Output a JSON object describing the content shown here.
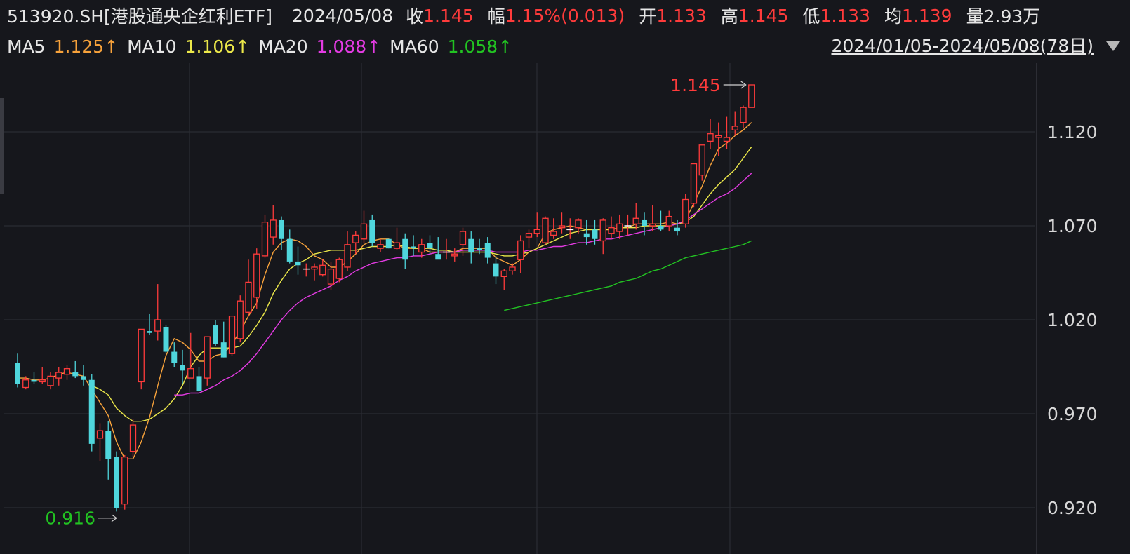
{
  "header": {
    "symbol": "513920.SH[港股通央企红利ETF]",
    "date": "2024/05/08",
    "close_label": "收",
    "close_value": "1.145",
    "change_label": "幅",
    "change_value": "1.15%(0.013)",
    "open_label": "开",
    "open_value": "1.133",
    "high_label": "高",
    "high_value": "1.145",
    "low_label": "低",
    "low_value": "1.133",
    "avg_label": "均",
    "avg_value": "1.139",
    "volume_label": "量",
    "volume_value": "2.93万"
  },
  "ma_legend": [
    {
      "label": "MA5",
      "value": "1.125↑",
      "color": "#f7a23b"
    },
    {
      "label": "MA10",
      "value": "1.106↑",
      "color": "#ece84a"
    },
    {
      "label": "MA20",
      "value": "1.088↑",
      "color": "#e43be3"
    },
    {
      "label": "MA60",
      "value": "1.058↑",
      "color": "#22c322"
    }
  ],
  "range_text": "2024/01/05-2024/05/08(78日)",
  "icons": {
    "range_dropdown": "triangle-down-icon"
  },
  "colors": {
    "background": "#16171c",
    "up": "#ff3b3b",
    "down": "#4fd6dc",
    "low_marker": "#22c322",
    "grid": "#2b2c33"
  },
  "chart_data": {
    "type": "candlestick",
    "y_ticks": [
      "1.120",
      "1.070",
      "1.020",
      "0.970",
      "0.920"
    ],
    "ylim": [
      0.908,
      1.17
    ],
    "high_marker": "1.145",
    "low_marker": "0.916",
    "ohlc": [
      [
        0.997,
        1.002,
        0.984,
        0.986
      ],
      [
        0.984,
        0.99,
        0.983,
        0.988
      ],
      [
        0.988,
        0.992,
        0.986,
        0.987
      ],
      [
        0.987,
        0.995,
        0.986,
        0.988
      ],
      [
        0.985,
        0.992,
        0.983,
        0.99
      ],
      [
        0.989,
        0.995,
        0.985,
        0.992
      ],
      [
        0.991,
        0.996,
        0.988,
        0.994
      ],
      [
        0.992,
        0.998,
        0.989,
        0.99
      ],
      [
        0.99,
        0.996,
        0.985,
        0.988
      ],
      [
        0.988,
        0.991,
        0.95,
        0.954
      ],
      [
        0.957,
        0.965,
        0.945,
        0.961
      ],
      [
        0.961,
        0.966,
        0.935,
        0.946
      ],
      [
        0.947,
        0.95,
        0.918,
        0.92
      ],
      [
        0.922,
        0.948,
        0.919,
        0.947
      ],
      [
        0.95,
        0.967,
        0.947,
        0.964
      ],
      [
        0.987,
        1.012,
        0.983,
        1.015
      ],
      [
        1.014,
        1.023,
        1.012,
        1.013
      ],
      [
        1.014,
        1.039,
        1.009,
        1.02
      ],
      [
        1.016,
        1.017,
        1.002,
        1.003
      ],
      [
        1.003,
        1.008,
        0.995,
        0.997
      ],
      [
        0.996,
        1.004,
        0.986,
        0.993
      ],
      [
        0.989,
        1.013,
        0.99,
        0.994
      ],
      [
        0.99,
        0.995,
        0.982,
        0.982
      ],
      [
        0.989,
        1.008,
        0.985,
        1.011
      ],
      [
        1.017,
        1.02,
        1.006,
        1.007
      ],
      [
        1.008,
        1.019,
        1.0,
        1.0
      ],
      [
        1.002,
        1.022,
        1.001,
        1.022
      ],
      [
        1.01,
        1.033,
        1.008,
        1.03
      ],
      [
        1.024,
        1.052,
        1.022,
        1.04
      ],
      [
        1.032,
        1.058,
        1.026,
        1.055
      ],
      [
        1.054,
        1.076,
        1.053,
        1.072
      ],
      [
        1.064,
        1.081,
        1.06,
        1.073
      ],
      [
        1.073,
        1.075,
        1.057,
        1.063
      ],
      [
        1.063,
        1.068,
        1.05,
        1.051
      ],
      [
        1.051,
        1.059,
        1.044,
        1.049
      ],
      [
        1.047,
        1.05,
        1.043,
        1.047
      ],
      [
        1.047,
        1.05,
        1.041,
        1.048
      ],
      [
        1.044,
        1.052,
        1.043,
        1.049
      ],
      [
        1.039,
        1.051,
        1.036,
        1.047
      ],
      [
        1.042,
        1.053,
        1.04,
        1.052
      ],
      [
        1.048,
        1.067,
        1.046,
        1.06
      ],
      [
        1.061,
        1.067,
        1.055,
        1.065
      ],
      [
        1.063,
        1.078,
        1.061,
        1.071
      ],
      [
        1.073,
        1.076,
        1.059,
        1.061
      ],
      [
        1.058,
        1.063,
        1.056,
        1.06
      ],
      [
        1.063,
        1.063,
        1.058,
        1.058
      ],
      [
        1.058,
        1.069,
        1.057,
        1.061
      ],
      [
        1.063,
        1.066,
        1.047,
        1.052
      ],
      [
        1.059,
        1.065,
        1.054,
        1.058
      ],
      [
        1.056,
        1.063,
        1.053,
        1.06
      ],
      [
        1.061,
        1.065,
        1.055,
        1.058
      ],
      [
        1.055,
        1.064,
        1.053,
        1.052
      ],
      [
        1.056,
        1.063,
        1.052,
        1.056
      ],
      [
        1.054,
        1.058,
        1.051,
        1.055
      ],
      [
        1.06,
        1.069,
        1.054,
        1.067
      ],
      [
        1.063,
        1.067,
        1.05,
        1.056
      ],
      [
        1.058,
        1.063,
        1.055,
        1.057
      ],
      [
        1.061,
        1.064,
        1.05,
        1.053
      ],
      [
        1.05,
        1.054,
        1.039,
        1.043
      ],
      [
        1.043,
        1.047,
        1.036,
        1.046
      ],
      [
        1.046,
        1.05,
        1.044,
        1.048
      ],
      [
        1.052,
        1.065,
        1.045,
        1.062
      ],
      [
        1.064,
        1.068,
        1.058,
        1.066
      ],
      [
        1.066,
        1.077,
        1.064,
        1.068
      ],
      [
        1.061,
        1.075,
        1.06,
        1.074
      ],
      [
        1.065,
        1.074,
        1.063,
        1.067
      ],
      [
        1.069,
        1.077,
        1.066,
        1.07
      ],
      [
        1.068,
        1.074,
        1.063,
        1.068
      ],
      [
        1.069,
        1.074,
        1.066,
        1.073
      ],
      [
        1.066,
        1.073,
        1.06,
        1.064
      ],
      [
        1.068,
        1.073,
        1.06,
        1.063
      ],
      [
        1.062,
        1.074,
        1.055,
        1.073
      ],
      [
        1.066,
        1.075,
        1.063,
        1.069
      ],
      [
        1.067,
        1.076,
        1.063,
        1.071
      ],
      [
        1.07,
        1.076,
        1.065,
        1.07
      ],
      [
        1.071,
        1.082,
        1.068,
        1.074
      ],
      [
        1.073,
        1.077,
        1.065,
        1.07
      ],
      [
        1.07,
        1.081,
        1.067,
        1.071
      ],
      [
        1.07,
        1.078,
        1.067,
        1.068
      ],
      [
        1.07,
        1.078,
        1.067,
        1.075
      ],
      [
        1.069,
        1.073,
        1.065,
        1.067
      ],
      [
        1.071,
        1.087,
        1.069,
        1.084
      ],
      [
        1.082,
        1.1,
        1.08,
        1.103
      ],
      [
        1.097,
        1.109,
        1.094,
        1.113
      ],
      [
        1.115,
        1.127,
        1.111,
        1.119
      ],
      [
        1.117,
        1.125,
        1.107,
        1.118
      ],
      [
        1.115,
        1.128,
        1.111,
        1.117
      ],
      [
        1.121,
        1.131,
        1.118,
        1.123
      ],
      [
        1.125,
        1.134,
        1.122,
        1.133
      ],
      [
        1.133,
        1.145,
        1.133,
        1.145
      ]
    ],
    "ma5": [
      0.989,
      0.989,
      0.988,
      0.988,
      0.989,
      0.991,
      0.992,
      0.991,
      0.99,
      0.983,
      0.976,
      0.969,
      0.955,
      0.946,
      0.946,
      0.955,
      0.968,
      0.985,
      1.001,
      1.01,
      1.008,
      1.004,
      0.998,
      0.998,
      1.001,
      1.002,
      1.007,
      1.014,
      1.022,
      1.029,
      1.044,
      1.056,
      1.061,
      1.063,
      1.062,
      1.059,
      1.054,
      1.052,
      1.048,
      1.048,
      1.051,
      1.055,
      1.06,
      1.062,
      1.063,
      1.063,
      1.06,
      1.058,
      1.058,
      1.058,
      1.056,
      1.056,
      1.056,
      1.056,
      1.058,
      1.058,
      1.058,
      1.058,
      1.053,
      1.051,
      1.049,
      1.052,
      1.056,
      1.058,
      1.066,
      1.068,
      1.069,
      1.07,
      1.069,
      1.068,
      1.068,
      1.068,
      1.068,
      1.069,
      1.069,
      1.071,
      1.071,
      1.071,
      1.071,
      1.072,
      1.071,
      1.073,
      1.082,
      1.091,
      1.102,
      1.111,
      1.114,
      1.118,
      1.121,
      1.125
    ],
    "ma10": [
      null,
      null,
      null,
      null,
      null,
      null,
      null,
      null,
      null,
      0.985,
      0.983,
      0.98,
      0.973,
      0.969,
      0.966,
      0.966,
      0.967,
      0.97,
      0.973,
      0.978,
      0.985,
      0.995,
      1.001,
      1.005,
      1.005,
      1.005,
      1.005,
      1.006,
      1.011,
      1.017,
      1.024,
      1.034,
      1.041,
      1.047,
      1.05,
      1.052,
      1.055,
      1.056,
      1.057,
      1.057,
      1.057,
      1.057,
      1.058,
      1.059,
      1.059,
      1.059,
      1.06,
      1.059,
      1.058,
      1.058,
      1.058,
      1.057,
      1.057,
      1.056,
      1.056,
      1.056,
      1.056,
      1.056,
      1.055,
      1.054,
      1.054,
      1.055,
      1.056,
      1.058,
      1.06,
      1.062,
      1.064,
      1.066,
      1.067,
      1.068,
      1.068,
      1.068,
      1.068,
      1.069,
      1.069,
      1.069,
      1.07,
      1.07,
      1.07,
      1.07,
      1.071,
      1.072,
      1.075,
      1.081,
      1.087,
      1.092,
      1.096,
      1.1,
      1.106,
      1.112
    ],
    "ma20": [
      null,
      null,
      null,
      null,
      null,
      null,
      null,
      null,
      null,
      null,
      null,
      null,
      null,
      null,
      null,
      null,
      null,
      null,
      null,
      0.98,
      0.98,
      0.981,
      0.981,
      0.983,
      0.985,
      0.988,
      0.99,
      0.993,
      0.997,
      1.002,
      1.008,
      1.014,
      1.02,
      1.025,
      1.029,
      1.032,
      1.034,
      1.036,
      1.038,
      1.041,
      1.043,
      1.046,
      1.048,
      1.05,
      1.051,
      1.052,
      1.053,
      1.053,
      1.054,
      1.054,
      1.055,
      1.056,
      1.056,
      1.056,
      1.057,
      1.057,
      1.057,
      1.057,
      1.056,
      1.056,
      1.056,
      1.056,
      1.057,
      1.057,
      1.058,
      1.059,
      1.059,
      1.06,
      1.061,
      1.061,
      1.062,
      1.063,
      1.063,
      1.064,
      1.065,
      1.066,
      1.067,
      1.068,
      1.069,
      1.07,
      1.071,
      1.073,
      1.076,
      1.079,
      1.082,
      1.085,
      1.087,
      1.09,
      1.094,
      1.098
    ],
    "ma60": [
      null,
      null,
      null,
      null,
      null,
      null,
      null,
      null,
      null,
      null,
      null,
      null,
      null,
      null,
      null,
      null,
      null,
      null,
      null,
      null,
      null,
      null,
      null,
      null,
      null,
      null,
      null,
      null,
      null,
      null,
      null,
      null,
      null,
      null,
      null,
      null,
      null,
      null,
      null,
      null,
      null,
      null,
      null,
      null,
      null,
      null,
      null,
      null,
      null,
      null,
      null,
      null,
      null,
      null,
      null,
      null,
      null,
      null,
      null,
      1.025,
      1.026,
      1.027,
      1.028,
      1.029,
      1.03,
      1.031,
      1.032,
      1.033,
      1.034,
      1.035,
      1.036,
      1.037,
      1.038,
      1.04,
      1.041,
      1.042,
      1.044,
      1.046,
      1.047,
      1.049,
      1.051,
      1.053,
      1.054,
      1.055,
      1.056,
      1.057,
      1.058,
      1.059,
      1.06,
      1.062
    ]
  }
}
